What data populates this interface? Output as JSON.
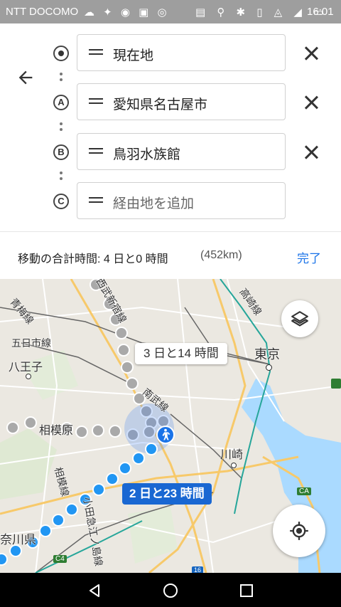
{
  "status_bar": {
    "carrier": "NTT DOCOMO",
    "time": "16:01",
    "left_icons": [
      "cloud-icon",
      "twitter-icon",
      "chat-icon",
      "line-icon",
      "app-icon"
    ],
    "right_icons": [
      "nfc-icon",
      "location-icon",
      "bluetooth-icon",
      "vibrate-icon",
      "wifi-icon",
      "signal-icon",
      "battery-icon"
    ]
  },
  "route": {
    "stops": [
      {
        "marker": "",
        "value": "現在地",
        "placeholder": ""
      },
      {
        "marker": "A",
        "value": "愛知県名古屋市",
        "placeholder": ""
      },
      {
        "marker": "B",
        "value": "鳥羽水族館",
        "placeholder": ""
      },
      {
        "marker": "C",
        "value": "",
        "placeholder": "経由地を追加"
      }
    ],
    "summary_label": "移動の合計時間: 4 日と0 時間",
    "summary_distance": "(452km)",
    "done_label": "完了"
  },
  "map": {
    "labels": {
      "ome": "青梅線",
      "itsukaichi": "五日市線",
      "hachioji": "八王子",
      "sagamihara": "相模原",
      "nambu": "南武線",
      "takasaki": "高崎線",
      "tokyo": "東京",
      "kawasaki": "川崎",
      "sagami_line": "相模線",
      "odakyu": "小田急江ノ島線",
      "kanagawa": "奈川県",
      "seibu": "西武新宿線",
      "route_c4": "C4",
      "route_ca": "CA",
      "route_16": "16"
    },
    "route_durations": {
      "alt": "3 日と14 時間",
      "selected": "2 日と23 時間"
    },
    "colors": {
      "selected_route": "#2196f3",
      "alt_route": "#a9a9a9",
      "accent": "#1a73e8",
      "water": "#aadaff"
    }
  }
}
